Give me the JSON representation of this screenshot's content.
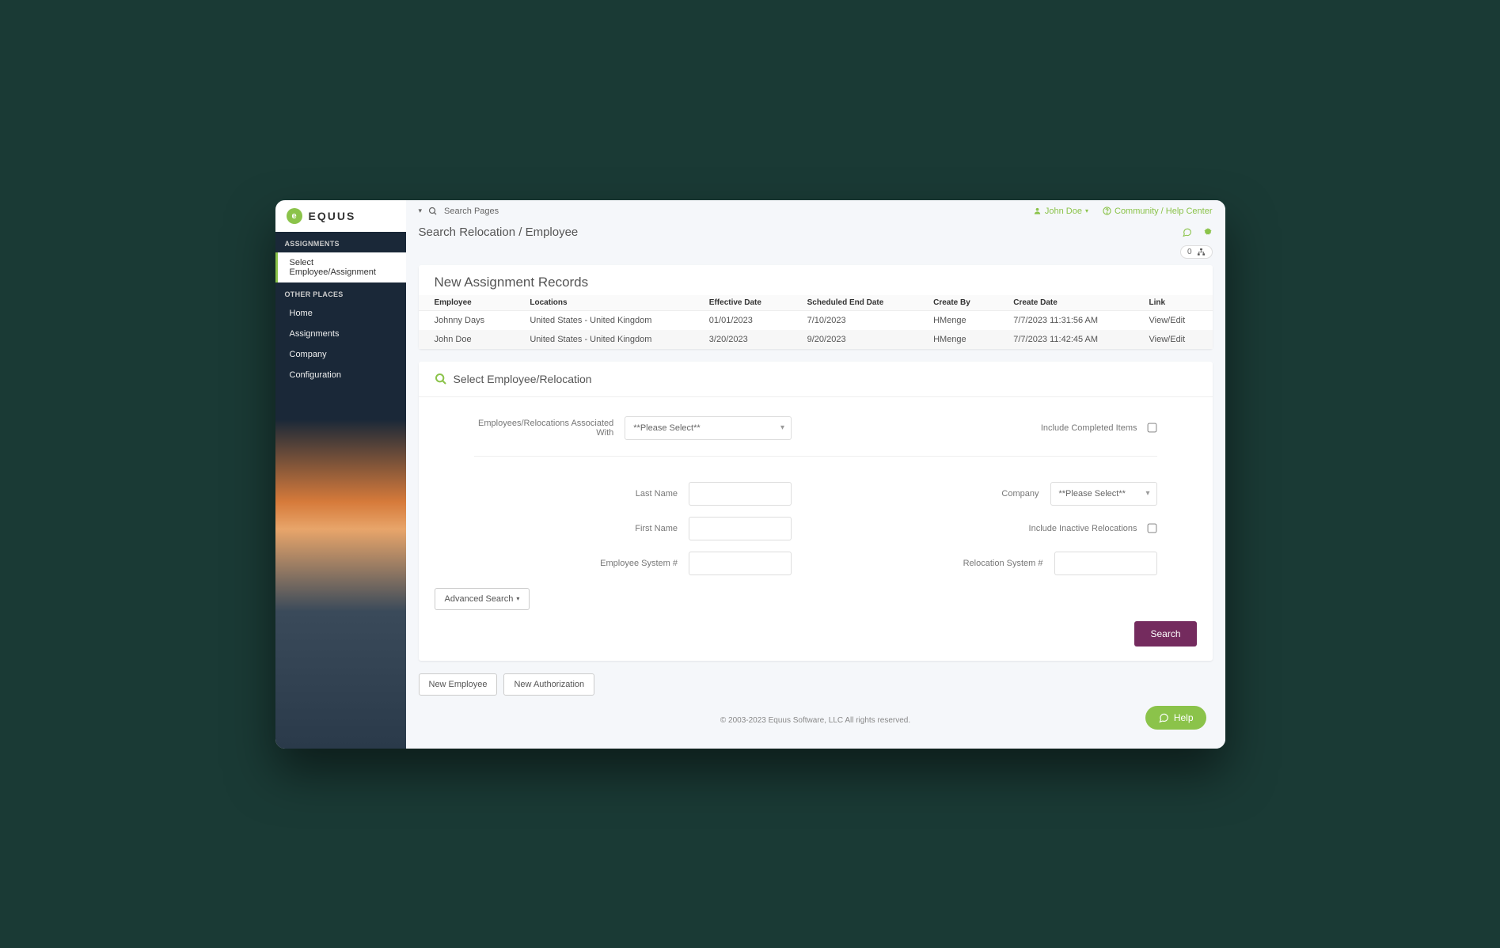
{
  "brand": {
    "name": "EQUUS"
  },
  "topbar": {
    "search_placeholder": "Search Pages",
    "user_label": "John Doe",
    "help_link": "Community / Help Center"
  },
  "sidebar": {
    "section1_title": "ASSIGNMENTS",
    "item_active": "Select Employee/Assignment",
    "section2_title": "OTHER PLACES",
    "items": [
      "Home",
      "Assignments",
      "Company",
      "Configuration"
    ]
  },
  "page": {
    "title": "Search Relocation / Employee",
    "badge_count": "0"
  },
  "records_panel": {
    "title": "New Assignment Records",
    "columns": [
      "Employee",
      "Locations",
      "Effective Date",
      "Scheduled End Date",
      "Create By",
      "Create Date",
      "Link"
    ],
    "rows": [
      {
        "employee": "Johnny Days",
        "locations": "United States - United Kingdom",
        "effective": "01/01/2023",
        "end": "7/10/2023",
        "createby": "HMenge",
        "createdate": "7/7/2023 11:31:56 AM",
        "link": "View/Edit"
      },
      {
        "employee": "John Doe",
        "locations": "United States - United Kingdom",
        "effective": "3/20/2023",
        "end": "9/20/2023",
        "createby": "HMenge",
        "createdate": "7/7/2023 11:42:45 AM",
        "link": "View/Edit"
      }
    ]
  },
  "search_panel": {
    "title": "Select Employee/Relocation",
    "assoc_label": "Employees/Relocations Associated With",
    "please_select": "**Please Select**",
    "include_completed": "Include Completed Items",
    "last_name": "Last Name",
    "first_name": "First Name",
    "emp_sys": "Employee System #",
    "company": "Company",
    "include_inactive": "Include Inactive Relocations",
    "reloc_sys": "Relocation System #",
    "advanced_search": "Advanced Search",
    "search_btn": "Search"
  },
  "actions": {
    "new_employee": "New Employee",
    "new_auth": "New Authorization"
  },
  "footer": "© 2003-2023 Equus Software, LLC All rights reserved.",
  "help_fab": "Help"
}
